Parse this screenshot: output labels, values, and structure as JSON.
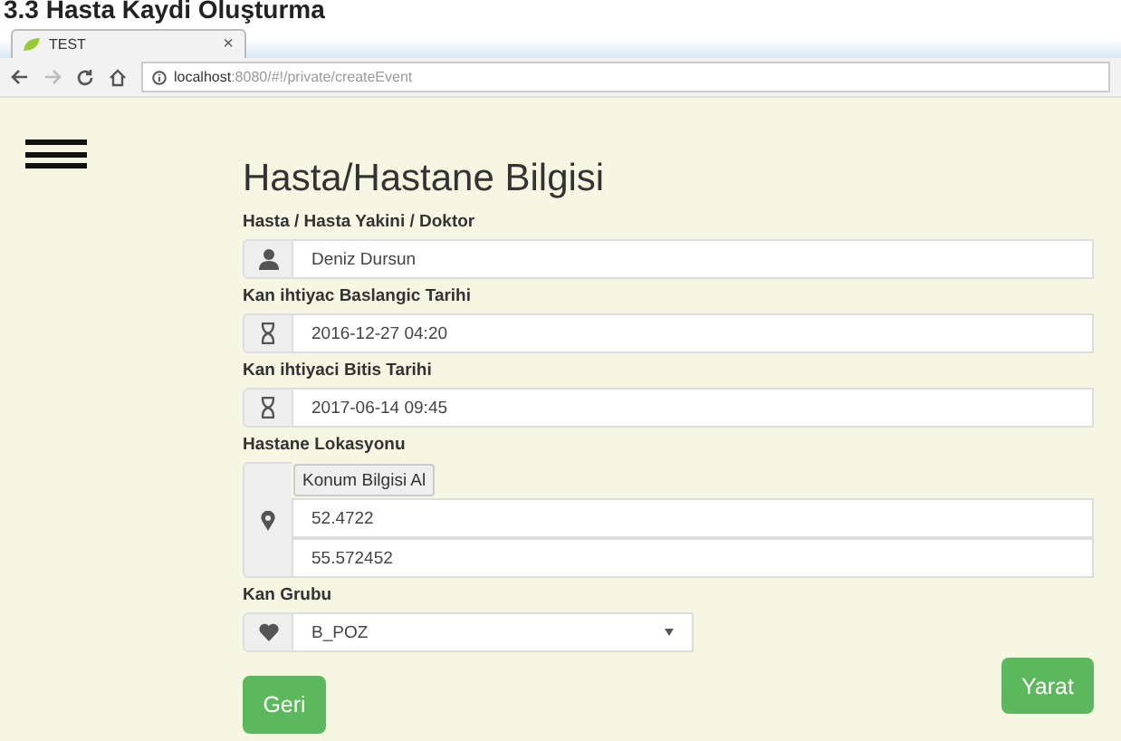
{
  "doc_heading": "3.3 Hasta Kaydi Oluşturma",
  "browser": {
    "tab_title": "TEST",
    "tab_close": "×",
    "url_host": "localhost",
    "url_rest": ":8080/#!/private/createEvent"
  },
  "form": {
    "title": "Hasta/Hastane Bilgisi",
    "fields": [
      {
        "kind": "person",
        "label": "Hasta / Hasta Yakini / Doktor",
        "value": "Deniz Dursun"
      },
      {
        "kind": "date",
        "label": "Kan ihtiyac Baslangic Tarihi",
        "value": "2016-12-27 04:20"
      },
      {
        "kind": "date",
        "label": "Kan ihtiyaci Bitis Tarihi",
        "value": "2017-06-14 09:45"
      },
      {
        "kind": "location",
        "label": "Hastane Lokasyonu",
        "button": "Konum Bilgisi Al",
        "values": [
          "52.4722",
          "55.572452"
        ]
      },
      {
        "kind": "select",
        "label": "Kan Grubu",
        "value": "B_POZ"
      }
    ],
    "back_button": "Geri",
    "create_button": "Yarat"
  }
}
